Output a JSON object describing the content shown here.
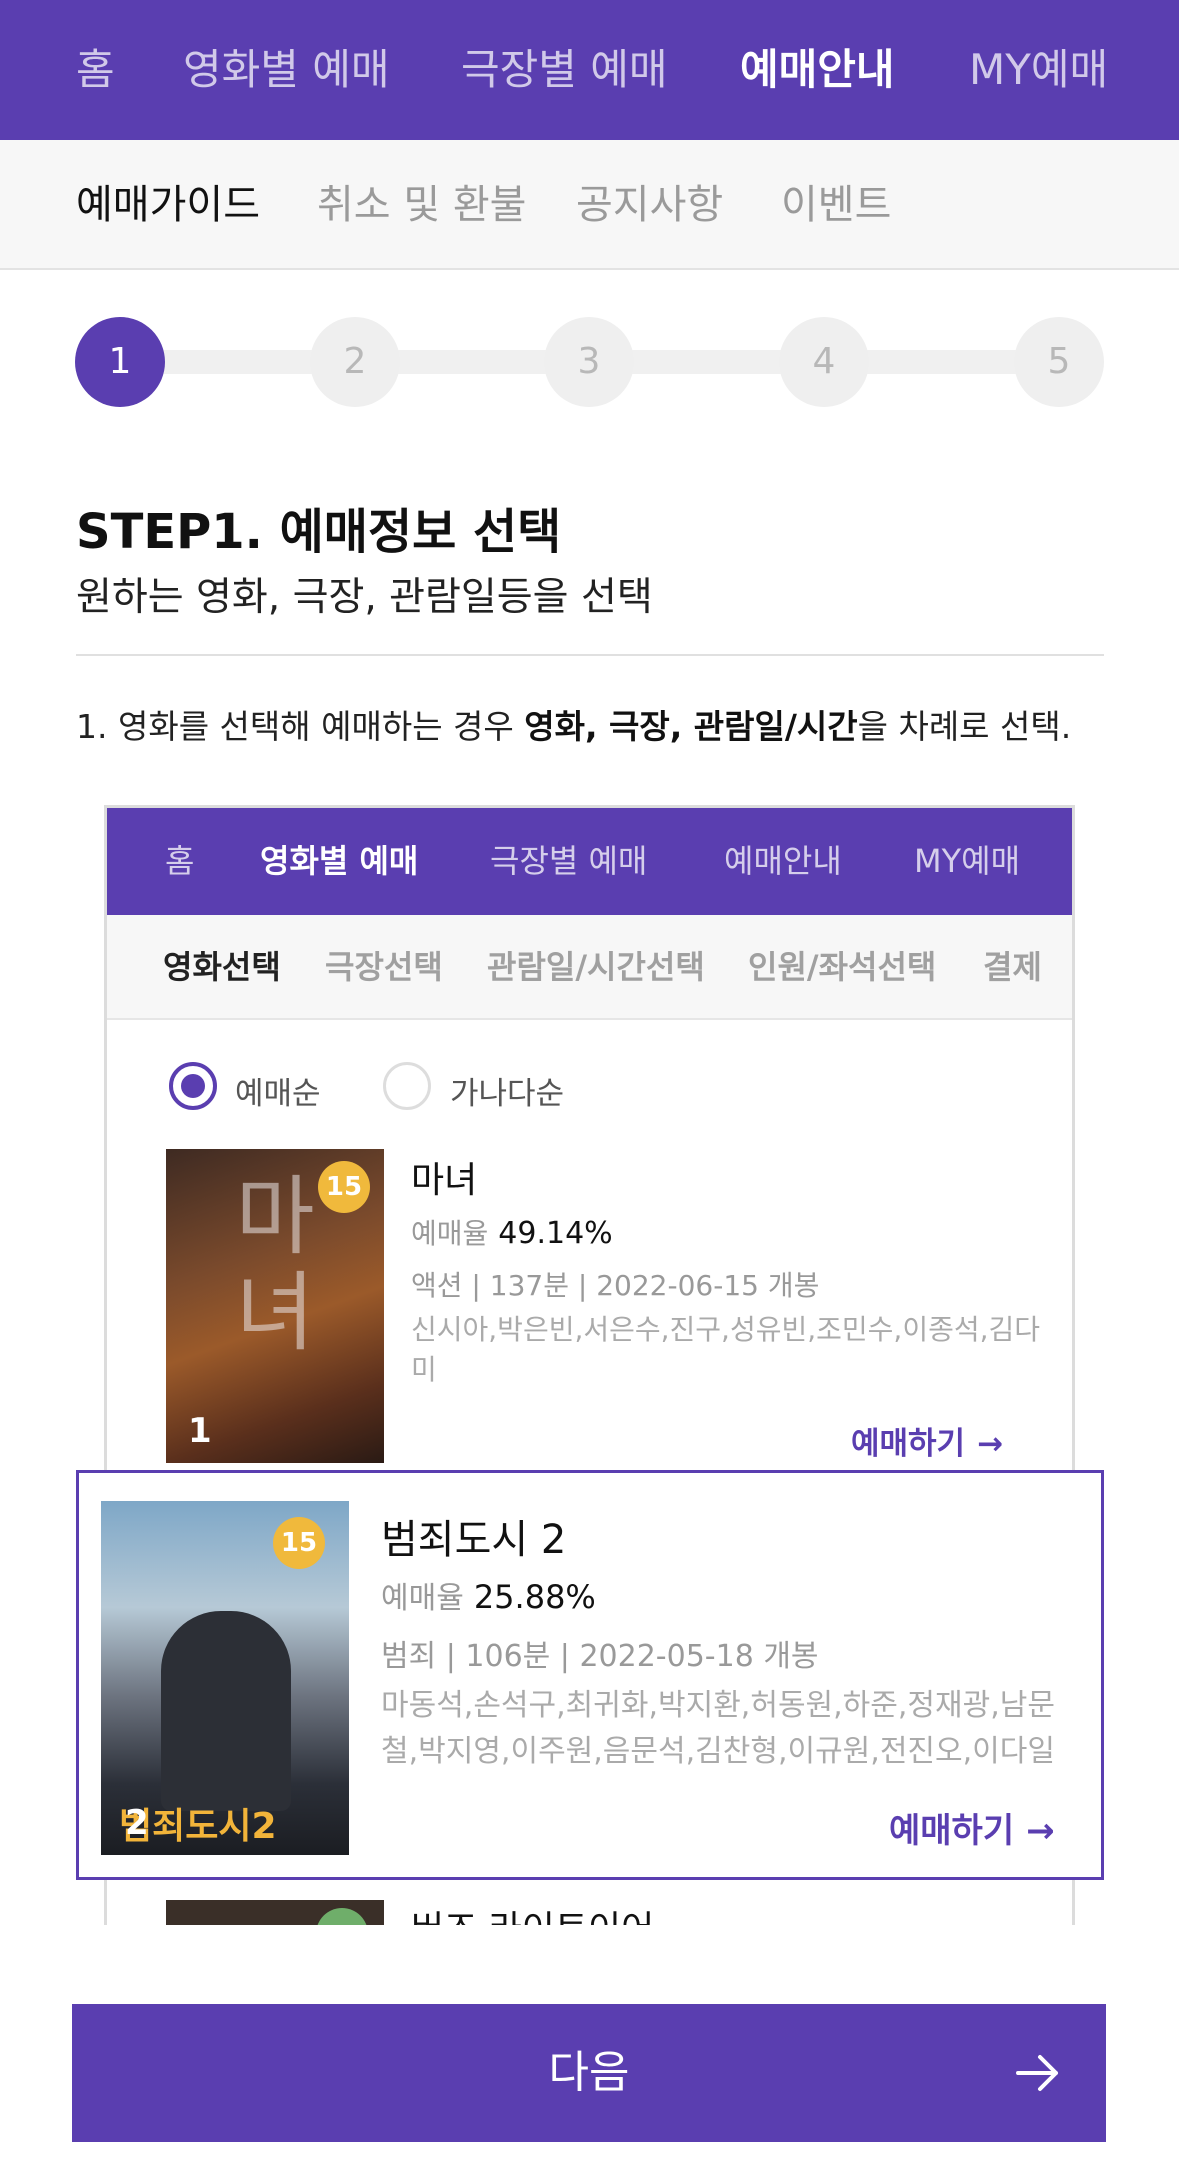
{
  "top_nav": {
    "items": [
      "홈",
      "영화별 예매",
      "극장별 예매",
      "예매안내",
      "MY예매"
    ]
  },
  "sub_nav": {
    "items": [
      "예매가이드",
      "취소 및 환불",
      "공지사항",
      "이벤트"
    ]
  },
  "stepper": {
    "steps": [
      "1",
      "2",
      "3",
      "4",
      "5"
    ],
    "current": 1
  },
  "step": {
    "title": "STEP1. 예매정보 선택",
    "subtitle": "원하는 영화, 극장, 관람일등을 선택"
  },
  "instruction": {
    "prefix": "1. 영화를 선택해 예매하는 경우 ",
    "bold": "영화, 극장, 관람일/시간",
    "suffix": "을 차례로 선택."
  },
  "example": {
    "nav": [
      "홈",
      "영화별 예매",
      "극장별 예매",
      "예매안내",
      "MY예매"
    ],
    "tabs": [
      "영화선택",
      "극장선택",
      "관람일/시간선택",
      "인원/좌석선택",
      "결제"
    ],
    "sort_options": [
      "예매순",
      "가나다순"
    ],
    "selected_sort": "예매순",
    "book_label": "예매하기",
    "rate_label": "예매율",
    "movies": [
      {
        "rank": "1",
        "rating": "15",
        "title": "마녀",
        "rate": "49.14%",
        "genre": "액션",
        "runtime": "137분",
        "release": "2022-06-15 개봉",
        "cast": "신시아,박은빈,서은수,진구,성유빈,조민수,이종석,김다미",
        "poster_text": "마녀"
      },
      {
        "rank": "2",
        "rating": "15",
        "title": "범죄도시 2",
        "rate": "25.88%",
        "genre": "범죄",
        "runtime": "106분",
        "release": "2022-05-18 개봉",
        "cast": "마동석,손석구,최귀화,박지환,허동원,하준,정재광,남문철,박지영,이주원,음문석,김찬형,이규원,전진오,이다일",
        "poster_text": "범죄도시2"
      },
      {
        "title": "버즈 라이트이어"
      }
    ]
  },
  "next_button": {
    "label": "다음"
  },
  "colors": {
    "brand": "#5a3eb0",
    "rating_badge": "#f0b93c"
  }
}
